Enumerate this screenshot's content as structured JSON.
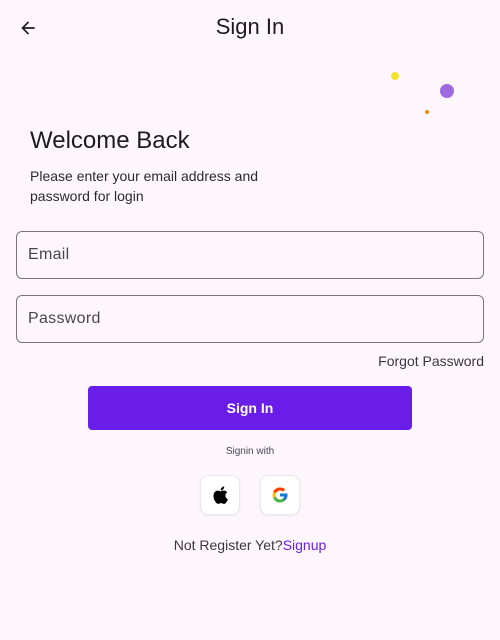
{
  "appbar": {
    "title": "Sign In",
    "back_icon": "arrow-back-icon"
  },
  "decor": {
    "dot_colors": [
      "#f4e12c",
      "#9f6ae0",
      "#f28a1c"
    ]
  },
  "header": {
    "title": "Welcome Back",
    "subtitle": "Please enter your email address and password for login"
  },
  "form": {
    "email_label": "Email",
    "password_label": "Password",
    "forgot_label": "Forgot Password",
    "signin_label": "Sign In"
  },
  "social": {
    "caption": "Signin with",
    "providers": [
      {
        "name": "Apple",
        "icon": "apple-icon"
      },
      {
        "name": "Google",
        "icon": "google-icon"
      }
    ]
  },
  "footer": {
    "prompt": "Not Register Yet?",
    "link": "Signup"
  },
  "colors": {
    "accent": "#6a1ce8",
    "link": "#6a1ce8",
    "background": "#fdf7fd"
  }
}
